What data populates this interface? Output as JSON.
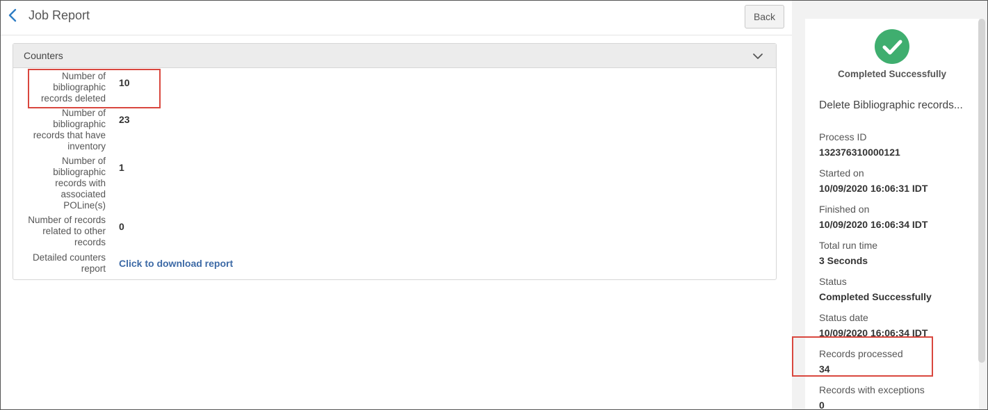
{
  "header": {
    "title": "Job Report",
    "back_label": "Back"
  },
  "counters": {
    "title": "Counters",
    "rows": [
      {
        "label_lines": [
          "Number of",
          "bibliographic",
          "records deleted"
        ],
        "value": "10"
      },
      {
        "label_lines": [
          "Number of",
          "bibliographic",
          "records that have",
          "inventory"
        ],
        "value": "23"
      },
      {
        "label_lines": [
          "Number of",
          "bibliographic",
          "records with",
          "associated",
          "POLine(s)"
        ],
        "value": "1"
      },
      {
        "label_lines": [
          "Number of records",
          "related to other",
          "records"
        ],
        "value": "0"
      },
      {
        "label_lines": [
          "Detailed counters",
          "report"
        ],
        "link": "Click to download report"
      }
    ]
  },
  "sidebar": {
    "status_heading": "Completed Successfully",
    "job_name": "Delete Bibliographic records...",
    "fields": [
      {
        "label": "Process ID",
        "value": "132376310000121"
      },
      {
        "label": "Started on",
        "value": "10/09/2020 16:06:31 IDT"
      },
      {
        "label": "Finished on",
        "value": "10/09/2020 16:06:34 IDT"
      },
      {
        "label": "Total run time",
        "value": "3 Seconds"
      },
      {
        "label": "Status",
        "value": "Completed Successfully"
      },
      {
        "label": "Status date",
        "value": "10/09/2020 16:06:34 IDT"
      },
      {
        "label": "Records processed",
        "value": "34"
      },
      {
        "label": "Records with exceptions",
        "value": "0"
      }
    ]
  },
  "colors": {
    "accent_link": "#3d6aa6",
    "success": "#3fae6f",
    "highlight": "#d9473e"
  }
}
